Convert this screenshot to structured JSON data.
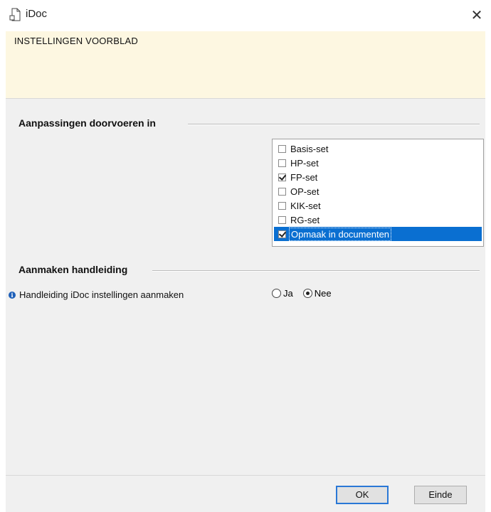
{
  "window": {
    "title": "iDoc",
    "close_symbol": "✕"
  },
  "header": {
    "title": "INSTELLINGEN VOORBLAD"
  },
  "group_adjustments": {
    "title": "Aanpassingen doorvoeren in",
    "items": [
      {
        "label": "Basis-set",
        "checked": false,
        "selected": false
      },
      {
        "label": "HP-set",
        "checked": false,
        "selected": false
      },
      {
        "label": "FP-set",
        "checked": true,
        "selected": false
      },
      {
        "label": "OP-set",
        "checked": false,
        "selected": false
      },
      {
        "label": "KIK-set",
        "checked": false,
        "selected": false
      },
      {
        "label": "RG-set",
        "checked": false,
        "selected": false
      },
      {
        "label": "Opmaak in documenten",
        "checked": true,
        "selected": true
      }
    ]
  },
  "group_manual": {
    "title": "Aanmaken handleiding",
    "info_label": "Handleiding iDoc instellingen aanmaken",
    "options": [
      {
        "label": "Ja",
        "selected": false
      },
      {
        "label": "Nee",
        "selected": true
      }
    ]
  },
  "footer": {
    "ok_label": "OK",
    "exit_label": "Einde"
  },
  "colors": {
    "header_bg": "#fdf7e1",
    "content_bg": "#f0f0f0",
    "selection": "#0a6fd1"
  }
}
